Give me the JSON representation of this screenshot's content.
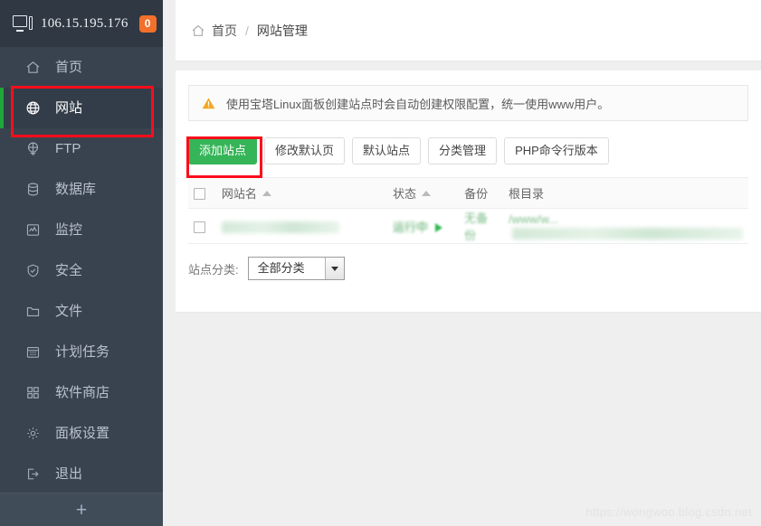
{
  "sidebar": {
    "header": {
      "icon": "monitor-icon",
      "ip": "106.15.195.176",
      "badge": "0"
    },
    "items": [
      {
        "label": "首页",
        "icon": "home-icon",
        "active": false
      },
      {
        "label": "网站",
        "icon": "globe-icon",
        "active": true
      },
      {
        "label": "FTP",
        "icon": "ftp-icon",
        "active": false
      },
      {
        "label": "数据库",
        "icon": "database-icon",
        "active": false
      },
      {
        "label": "监控",
        "icon": "monitor-chart-icon",
        "active": false
      },
      {
        "label": "安全",
        "icon": "shield-icon",
        "active": false
      },
      {
        "label": "文件",
        "icon": "folder-icon",
        "active": false
      },
      {
        "label": "计划任务",
        "icon": "calendar-icon",
        "active": false
      },
      {
        "label": "软件商店",
        "icon": "grid-icon",
        "active": false
      },
      {
        "label": "面板设置",
        "icon": "gear-icon",
        "active": false
      },
      {
        "label": "退出",
        "icon": "logout-icon",
        "active": false
      }
    ],
    "footer": {
      "label": "+",
      "icon": "plus-icon"
    }
  },
  "breadcrumb": {
    "home_icon": "home-icon",
    "home": "首页",
    "separator": "/",
    "current": "网站管理"
  },
  "alert": {
    "icon": "warning-triangle-icon",
    "text": "使用宝塔Linux面板创建站点时会自动创建权限配置，统一使用www用户。"
  },
  "toolbar": {
    "add_site": "添加站点",
    "edit_default_page": "修改默认页",
    "default_site": "默认站点",
    "category_manage": "分类管理",
    "php_cli_version": "PHP命令行版本"
  },
  "table": {
    "headers": {
      "select_all": "",
      "name": "网站名",
      "status": "状态",
      "backup": "备份",
      "root_dir": "根目录"
    },
    "sort_indicator": "▲",
    "rows": [
      {
        "name": "",
        "status": "运行中",
        "backup": "无备份",
        "root_dir": "/www/w..."
      }
    ]
  },
  "filter": {
    "label": "站点分类:",
    "selected": "全部分类"
  },
  "watermark": "https://wongwoo.blog.csdn.net",
  "colors": {
    "sidebar_bg": "#39434f",
    "sidebar_header_bg": "#2f3843",
    "active_accent": "#20a53a",
    "badge_orange": "#f2702a",
    "primary_green": "#35b558",
    "annotation_red": "#fc0d1c"
  }
}
